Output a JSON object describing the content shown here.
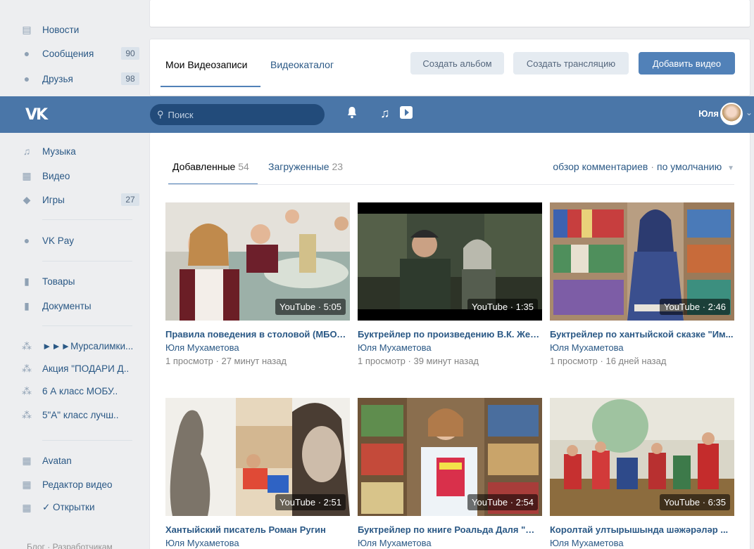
{
  "sidebar": {
    "top_items": [
      {
        "label": "Новости",
        "icon": "news-icon",
        "count": ""
      },
      {
        "label": "Сообщения",
        "icon": "messages-icon",
        "count": "90"
      },
      {
        "label": "Друзья",
        "icon": "friends-icon",
        "count": "98"
      }
    ],
    "items": [
      {
        "label": "Музыка",
        "icon": "music-icon",
        "count": ""
      },
      {
        "label": "Видео",
        "icon": "video-icon",
        "count": ""
      },
      {
        "label": "Игры",
        "icon": "games-icon",
        "count": "27"
      },
      {
        "label": "VK Pay",
        "icon": "vkpay-icon",
        "count": ""
      },
      {
        "label": "Товары",
        "icon": "goods-icon",
        "count": ""
      },
      {
        "label": "Документы",
        "icon": "documents-icon",
        "count": ""
      },
      {
        "label": "►►►Мурсалимки...",
        "icon": "group-icon",
        "count": ""
      },
      {
        "label": "Акция \"ПОДАРИ Д..",
        "icon": "group-icon",
        "count": ""
      },
      {
        "label": "6 А класс МОБУ..",
        "icon": "group-icon",
        "count": ""
      },
      {
        "label": "5\"А\" класс лучш..",
        "icon": "group-icon",
        "count": ""
      },
      {
        "label": "Avatan",
        "icon": "app-icon",
        "count": ""
      },
      {
        "label": "Редактор видео",
        "icon": "app-icon",
        "count": ""
      },
      {
        "label": "✓ Открытки",
        "icon": "app-icon",
        "count": ""
      }
    ],
    "footer": "Блог · Разработчикам"
  },
  "top_tabs": {
    "my_videos": "Мои Видеозаписи",
    "catalog": "Видеокаталог",
    "create_album": "Создать альбом",
    "create_stream": "Создать трансляцию",
    "add_video": "Добавить видео"
  },
  "header": {
    "logo": "VK",
    "search_placeholder": "Поиск",
    "user_name": "Юля"
  },
  "sub_tabs": {
    "added_label": "Добавленные",
    "added_count": "54",
    "uploaded_label": "Загруженные",
    "uploaded_count": "23",
    "comments": "обзор комментариев",
    "sort": "по умолчанию"
  },
  "videos": [
    {
      "title": "Правила поведения в столовой (МБОУ ...",
      "author": "Юля Мухаметова",
      "meta": "1 просмотр · 27 минут назад",
      "badge": "YouTube · 5:05"
    },
    {
      "title": "Буктрейлер по произведению В.К. Жел...",
      "author": "Юля Мухаметова",
      "meta": "1 просмотр · 39 минут назад",
      "badge": "YouTube · 1:35"
    },
    {
      "title": "Буктрейлер по хантыйской сказке \"Им...",
      "author": "Юля Мухаметова",
      "meta": "1 просмотр · 16 дней назад",
      "badge": "YouTube · 2:46"
    },
    {
      "title": "Хантыйский писатель Роман Ругин",
      "author": "Юля Мухаметова",
      "meta": "",
      "badge": "YouTube · 2:51"
    },
    {
      "title": "Буктрейлер по книге Роальда Даля \"Ма...",
      "author": "Юля Мухаметова",
      "meta": "",
      "badge": "YouTube · 2:54"
    },
    {
      "title": "Королтай ултырышында шәжәрәләр ...",
      "author": "Юля Мухаметова",
      "meta": "",
      "badge": "YouTube · 6:35"
    }
  ]
}
